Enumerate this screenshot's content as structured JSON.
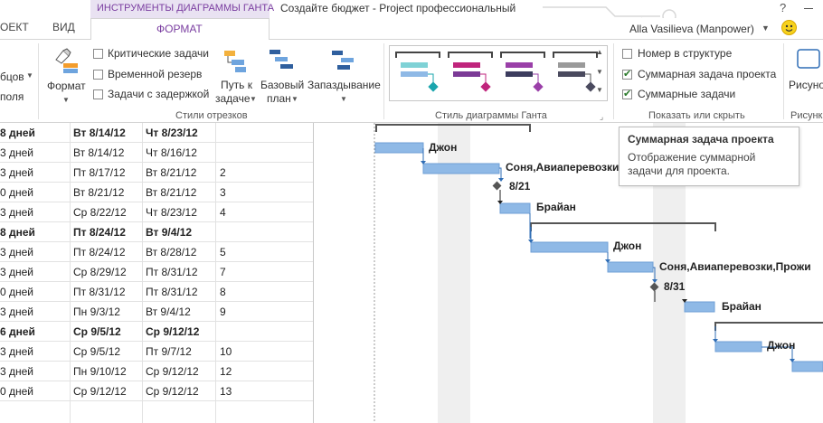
{
  "titlebar": {
    "context_tab": "ИНСТРУМЕНТЫ ДИАГРАММЫ ГАНТА",
    "title": "Создайте бюджет - Project профессиональный",
    "help": "?",
    "user": "Alla Vasilieva (Manpower)"
  },
  "tabs": {
    "project": "ОЕКТ",
    "view": "ВИД",
    "format": "ФОРМАТ"
  },
  "ribbon": {
    "left_label1": "бцов",
    "left_label2": "поля",
    "format_button": "Формат",
    "checks": {
      "critical": "Критические задачи",
      "slack": "Временной резерв",
      "late": "Задачи с задержкой"
    },
    "path_button1": "Путь к",
    "path_button2": "задаче",
    "baseline1": "Базовый",
    "baseline2": "план",
    "slippage": "Запаздывание",
    "group_bar_styles": "Стили отрезков",
    "group_gantt_style": "Стиль диаграммы Ганта",
    "show_hide": {
      "outline_number": "Номер в структуре",
      "project_summary": "Суммарная задача проекта",
      "summary_tasks": "Суммарные задачи"
    },
    "group_show_hide": "Показать или скрыть",
    "drawing": "Рисунок",
    "drawing2": "Рисунк"
  },
  "tooltip": {
    "title": "Суммарная задача проекта",
    "body": "Отображение суммарной задачи для проекта."
  },
  "rows": [
    {
      "dur": "8 дней",
      "start": "Вт 8/14/12",
      "finish": "Чт 8/23/12",
      "pred": "",
      "bold": true
    },
    {
      "dur": "3 дней",
      "start": "Вт 8/14/12",
      "finish": "Чт 8/16/12",
      "pred": "",
      "bold": false
    },
    {
      "dur": "3 дней",
      "start": "Пт 8/17/12",
      "finish": "Вт 8/21/12",
      "pred": "2",
      "bold": false
    },
    {
      "dur": "0 дней",
      "start": "Вт 8/21/12",
      "finish": "Вт 8/21/12",
      "pred": "3",
      "bold": false
    },
    {
      "dur": "3 дней",
      "start": "Ср 8/22/12",
      "finish": "Чт 8/23/12",
      "pred": "4",
      "bold": false
    },
    {
      "dur": "8 дней",
      "start": "Пт 8/24/12",
      "finish": "Вт 9/4/12",
      "pred": "",
      "bold": true
    },
    {
      "dur": "3 дней",
      "start": "Пт 8/24/12",
      "finish": "Вт 8/28/12",
      "pred": "5",
      "bold": false
    },
    {
      "dur": "3 дней",
      "start": "Ср 8/29/12",
      "finish": "Пт 8/31/12",
      "pred": "7",
      "bold": false
    },
    {
      "dur": "0 дней",
      "start": "Пт 8/31/12",
      "finish": "Пт 8/31/12",
      "pred": "8",
      "bold": false
    },
    {
      "dur": "3 дней",
      "start": "Пн 9/3/12",
      "finish": "Вт 9/4/12",
      "pred": "9",
      "bold": false
    },
    {
      "dur": "6 дней",
      "start": "Ср 9/5/12",
      "finish": "Ср 9/12/12",
      "pred": "",
      "bold": true
    },
    {
      "dur": "3 дней",
      "start": "Ср 9/5/12",
      "finish": "Пт 9/7/12",
      "pred": "10",
      "bold": false
    },
    {
      "dur": "3 дней",
      "start": "Пн 9/10/12",
      "finish": "Ср 9/12/12",
      "pred": "12",
      "bold": false
    },
    {
      "dur": "0 дней",
      "start": "Ср 9/12/12",
      "finish": "Ср 9/12/12",
      "pred": "13",
      "bold": false
    }
  ],
  "gantt_labels": {
    "john1": "Джон",
    "sonya1": "Соня,Авиаперевозки,",
    "m1": "8/21",
    "brian1": "Брайан",
    "john2": "Джон",
    "sonya2": "Соня,Авиаперевозки,Прожи",
    "m2": "8/31",
    "brian2": "Брайан",
    "john3": "Джон"
  }
}
